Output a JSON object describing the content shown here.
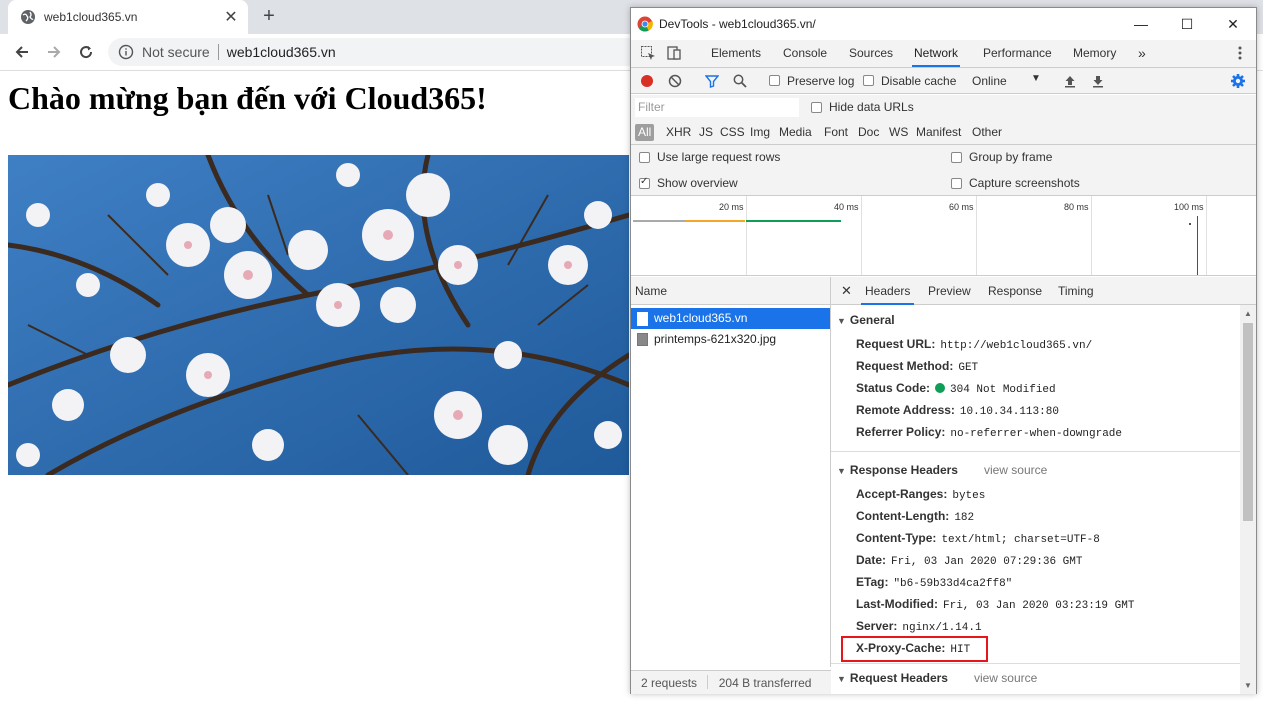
{
  "browser": {
    "tab_title": "web1cloud365.vn",
    "security_label": "Not secure",
    "url": "web1cloud365.vn"
  },
  "page": {
    "heading": "Chào mừng bạn đến với Cloud365!"
  },
  "devtools": {
    "window_title": "DevTools - web1cloud365.vn/",
    "tabs": [
      "Elements",
      "Console",
      "Sources",
      "Network",
      "Performance",
      "Memory"
    ],
    "more_tabs": "»",
    "toolbar": {
      "preserve_log": "Preserve log",
      "disable_cache": "Disable cache",
      "throttle": "Online"
    },
    "filter": {
      "placeholder": "Filter",
      "hide_data_urls": "Hide data URLs"
    },
    "types": [
      "All",
      "XHR",
      "JS",
      "CSS",
      "Img",
      "Media",
      "Font",
      "Doc",
      "WS",
      "Manifest",
      "Other"
    ],
    "options": {
      "large_rows": "Use large request rows",
      "group_by_frame": "Group by frame",
      "show_overview": "Show overview",
      "capture_screenshots": "Capture screenshots"
    },
    "timeline_labels": [
      "20 ms",
      "40 ms",
      "60 ms",
      "80 ms",
      "100 ms"
    ],
    "list_header": "Name",
    "requests": [
      "web1cloud365.vn",
      "printemps-621x320.jpg"
    ],
    "status": {
      "requests": "2 requests",
      "transferred": "204 B transferred"
    },
    "detail_tabs": [
      "Headers",
      "Preview",
      "Response",
      "Timing"
    ],
    "general": {
      "title": "General",
      "request_url_label": "Request URL:",
      "request_url": "http://web1cloud365.vn/",
      "method_label": "Request Method:",
      "method": "GET",
      "status_label": "Status Code:",
      "status": "304 Not Modified",
      "remote_label": "Remote Address:",
      "remote": "10.10.34.113:80",
      "referrer_label": "Referrer Policy:",
      "referrer": "no-referrer-when-downgrade"
    },
    "response_headers": {
      "title": "Response Headers",
      "view_source": "view source",
      "rows": [
        {
          "name": "Accept-Ranges:",
          "value": "bytes"
        },
        {
          "name": "Content-Length:",
          "value": "182"
        },
        {
          "name": "Content-Type:",
          "value": "text/html; charset=UTF-8"
        },
        {
          "name": "Date:",
          "value": "Fri, 03 Jan 2020 07:29:36 GMT"
        },
        {
          "name": "ETag:",
          "value": "\"b6-59b33d4ca2ff8\""
        },
        {
          "name": "Last-Modified:",
          "value": "Fri, 03 Jan 2020 03:23:19 GMT"
        },
        {
          "name": "Server:",
          "value": "nginx/1.14.1"
        },
        {
          "name": "X-Proxy-Cache:",
          "value": "HIT"
        }
      ]
    },
    "request_headers": {
      "title": "Request Headers",
      "view_source": "view source"
    },
    "colors": {
      "accent": "#1a73e8",
      "record_red": "#d93025",
      "status_green": "#0f9d58",
      "highlight_red": "#e8161b"
    }
  }
}
